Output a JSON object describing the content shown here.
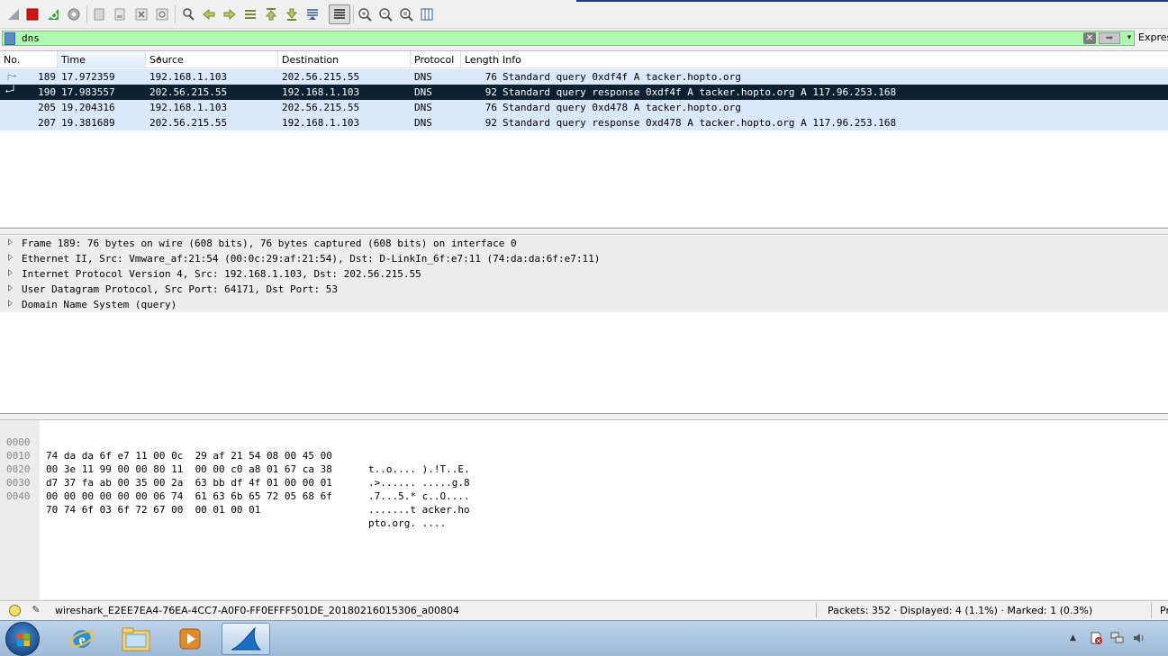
{
  "toolbar": {
    "buttons": [
      "shark-fin-start-icon",
      "stop-icon",
      "restart-icon",
      "options-icon",
      "open-icon",
      "save-icon",
      "close-icon",
      "reload-icon",
      "find-icon",
      "back-icon",
      "forward-icon",
      "goto-icon",
      "first-icon",
      "last-icon",
      "autoscroll-icon",
      "colorize-icon",
      "zoom-in-icon",
      "zoom-out-icon",
      "normal-size-icon",
      "resize-columns-icon"
    ]
  },
  "filter": {
    "value": "dns",
    "clear_glyph": "✕",
    "apply_glyph": "➡",
    "dropdown_glyph": "▾",
    "expression_label": "Expres"
  },
  "packet_list": {
    "columns": [
      "No.",
      "Time",
      "Source",
      "Destination",
      "Protocol",
      "Length",
      "Info"
    ],
    "rows": [
      {
        "no": "189",
        "time": "17.972359",
        "src": "192.168.1.103",
        "dst": "202.56.215.55",
        "proto": "DNS",
        "len": "76",
        "info": "Standard query 0xdf4f A tacker.hopto.org",
        "mark": "┌→"
      },
      {
        "no": "190",
        "time": "17.983557",
        "src": "202.56.215.55",
        "dst": "192.168.1.103",
        "proto": "DNS",
        "len": "92",
        "info": "Standard query response 0xdf4f A tacker.hopto.org A 117.96.253.168",
        "mark": "←┘"
      },
      {
        "no": "205",
        "time": "19.204316",
        "src": "192.168.1.103",
        "dst": "202.56.215.55",
        "proto": "DNS",
        "len": "76",
        "info": "Standard query 0xd478 A tacker.hopto.org",
        "mark": ""
      },
      {
        "no": "207",
        "time": "19.381689",
        "src": "202.56.215.55",
        "dst": "192.168.1.103",
        "proto": "DNS",
        "len": "92",
        "info": "Standard query response 0xd478 A tacker.hopto.org A 117.96.253.168",
        "mark": ""
      }
    ]
  },
  "details": {
    "items": [
      "Frame 189: 76 bytes on wire (608 bits), 76 bytes captured (608 bits) on interface 0",
      "Ethernet II, Src: Vmware_af:21:54 (00:0c:29:af:21:54), Dst: D-LinkIn_6f:e7:11 (74:da:da:6f:e7:11)",
      "Internet Protocol Version 4, Src: 192.168.1.103, Dst: 202.56.215.55",
      "User Datagram Protocol, Src Port: 64171, Dst Port: 53",
      "Domain Name System (query)"
    ]
  },
  "bytes": {
    "rows": [
      {
        "offset": "0000",
        "hex": "74 da da 6f e7 11 00 0c  29 af 21 54 08 00 45 00",
        "ascii": "t..o.... ).!T..E."
      },
      {
        "offset": "0010",
        "hex": "00 3e 11 99 00 00 80 11  00 00 c0 a8 01 67 ca 38",
        "ascii": ".>...... .....g.8"
      },
      {
        "offset": "0020",
        "hex": "d7 37 fa ab 00 35 00 2a  63 bb df 4f 01 00 00 01",
        "ascii": ".7...5.* c..O...."
      },
      {
        "offset": "0030",
        "hex": "00 00 00 00 00 00 06 74  61 63 6b 65 72 05 68 6f",
        "ascii": ".......t acker.ho"
      },
      {
        "offset": "0040",
        "hex": "70 74 6f 03 6f 72 67 00  00 01 00 01",
        "ascii": "pto.org. ...."
      }
    ]
  },
  "status": {
    "file": "wireshark_E2EE7EA4-76EA-4CC7-A0F0-FF0EFFF501DE_20180216015306_a00804",
    "packets": "Packets: 352 · Displayed: 4 (1.1%) · Marked: 1 (0.3%)",
    "profile": "Pr"
  },
  "taskbar": {
    "apps": [
      "internet-explorer-icon",
      "file-explorer-icon",
      "media-player-icon",
      "wireshark-icon"
    ],
    "tray": [
      "show-hidden-icons-icon",
      "action-center-icon",
      "network-icon",
      "volume-icon"
    ]
  },
  "colors": {
    "filter_bg": "#aff9af",
    "row_bg": "#dae8fc",
    "selected_bg": "#0b2131"
  }
}
